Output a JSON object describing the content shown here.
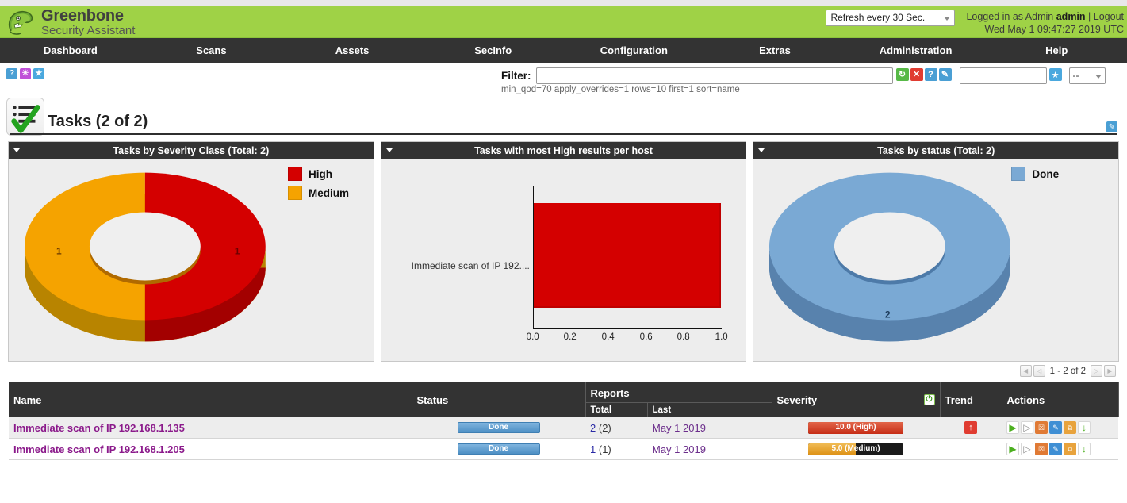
{
  "header": {
    "brand_title": "Greenbone",
    "brand_sub": "Security Assistant",
    "refresh_value": "Refresh every 30 Sec.",
    "logged_in_prefix": "Logged in as Admin",
    "user": "admin",
    "separator": "|",
    "logout": "Logout",
    "datetime": "Wed May 1 09:47:27 2019 UTC",
    "brand_color": "#9fd246"
  },
  "nav": {
    "items": [
      {
        "label": "Dashboard"
      },
      {
        "label": "Scans"
      },
      {
        "label": "Assets"
      },
      {
        "label": "SecInfo"
      },
      {
        "label": "Configuration"
      },
      {
        "label": "Extras"
      },
      {
        "label": "Administration"
      },
      {
        "label": "Help"
      }
    ]
  },
  "toolbar": {
    "icons": [
      {
        "name": "help-icon",
        "glyph": "?"
      },
      {
        "name": "wizard-icon",
        "glyph": "✳"
      },
      {
        "name": "star-icon",
        "glyph": "★"
      }
    ],
    "filter_label": "Filter:",
    "filter_value": "",
    "filter_placeholder": "",
    "filter_terms": "min_qod=70 apply_overrides=1 rows=10 first=1 sort=name",
    "filter_name_value": "",
    "filter_select_value": "--",
    "buttons": [
      {
        "name": "refresh-filter-button",
        "glyph": "↻"
      },
      {
        "name": "reset-filter-button",
        "glyph": "✕"
      },
      {
        "name": "filter-help-button",
        "glyph": "?"
      },
      {
        "name": "edit-filter-button",
        "glyph": "✎"
      }
    ]
  },
  "page": {
    "title": "Tasks (2 of 2)",
    "edit_icon_glyph": "✎"
  },
  "panels": [
    {
      "title": "Tasks by Severity Class (Total: 2)"
    },
    {
      "title": "Tasks with most High results per host"
    },
    {
      "title": "Tasks by status (Total: 2)"
    }
  ],
  "chart_data": [
    {
      "type": "pie",
      "title": "Tasks by Severity Class (Total: 2)",
      "donut": true,
      "labels": [
        "High",
        "Medium"
      ],
      "values": [
        1,
        1
      ],
      "colors": [
        "#d40000",
        "#f5a300"
      ],
      "data_labels": [
        "1",
        "1"
      ],
      "legend_position": "right",
      "legend": [
        "High",
        "Medium"
      ]
    },
    {
      "type": "bar",
      "orientation": "horizontal",
      "title": "Tasks with most High results per host",
      "categories": [
        "Immediate scan of IP 192...."
      ],
      "values": [
        1.0
      ],
      "colors": [
        "#d40000"
      ],
      "xlabel": "",
      "ylabel": "",
      "xlim": [
        0.0,
        1.0
      ],
      "xticks": [
        "0.0",
        "0.2",
        "0.4",
        "0.6",
        "0.8",
        "1.0"
      ],
      "grid": false,
      "legend_position": "none"
    },
    {
      "type": "pie",
      "title": "Tasks by status (Total: 2)",
      "donut": true,
      "labels": [
        "Done"
      ],
      "values": [
        2
      ],
      "colors": [
        "#7aa9d4"
      ],
      "data_labels": [
        "2"
      ],
      "legend_position": "right",
      "legend": [
        "Done"
      ]
    }
  ],
  "pager": {
    "text": "1 - 2 of 2",
    "first_glyph": "◀",
    "prev_glyph": "◁",
    "next_glyph": "▷",
    "last_glyph": "▶"
  },
  "table": {
    "headers": {
      "name": "Name",
      "status": "Status",
      "reports": "Reports",
      "reports_total": "Total",
      "reports_last": "Last",
      "severity": "Severity",
      "trend": "Trend",
      "actions": "Actions"
    },
    "rows": [
      {
        "name": "Immediate scan of IP 192.168.1.135",
        "status": "Done",
        "reports_total": "2",
        "reports_total_paren": "(2)",
        "reports_last": "May 1 2019",
        "severity_text": "10.0 (High)",
        "severity_value": 10.0,
        "severity_pct": 100,
        "severity_color": "#d94c2f",
        "trend": "up",
        "trend_glyph": "↑",
        "actions": [
          {
            "name": "start-task-action",
            "glyph": "▶"
          },
          {
            "name": "resume-task-action",
            "glyph": "▷"
          },
          {
            "name": "move-to-trash-action",
            "glyph": "☒"
          },
          {
            "name": "edit-task-action",
            "glyph": "✎"
          },
          {
            "name": "clone-task-action",
            "glyph": "⧉"
          },
          {
            "name": "export-task-action",
            "glyph": "↓"
          }
        ]
      },
      {
        "name": "Immediate scan of IP 192.168.1.205",
        "status": "Done",
        "reports_total": "1",
        "reports_total_paren": "(1)",
        "reports_last": "May 1 2019",
        "severity_text": "5.0 (Medium)",
        "severity_value": 5.0,
        "severity_pct": 50,
        "severity_color": "#e8a33d",
        "trend": "none",
        "trend_glyph": "",
        "actions": [
          {
            "name": "start-task-action",
            "glyph": "▶"
          },
          {
            "name": "resume-task-action",
            "glyph": "▷"
          },
          {
            "name": "move-to-trash-action",
            "glyph": "☒"
          },
          {
            "name": "edit-task-action",
            "glyph": "✎"
          },
          {
            "name": "clone-task-action",
            "glyph": "⧉"
          },
          {
            "name": "export-task-action",
            "glyph": "↓"
          }
        ]
      }
    ]
  }
}
